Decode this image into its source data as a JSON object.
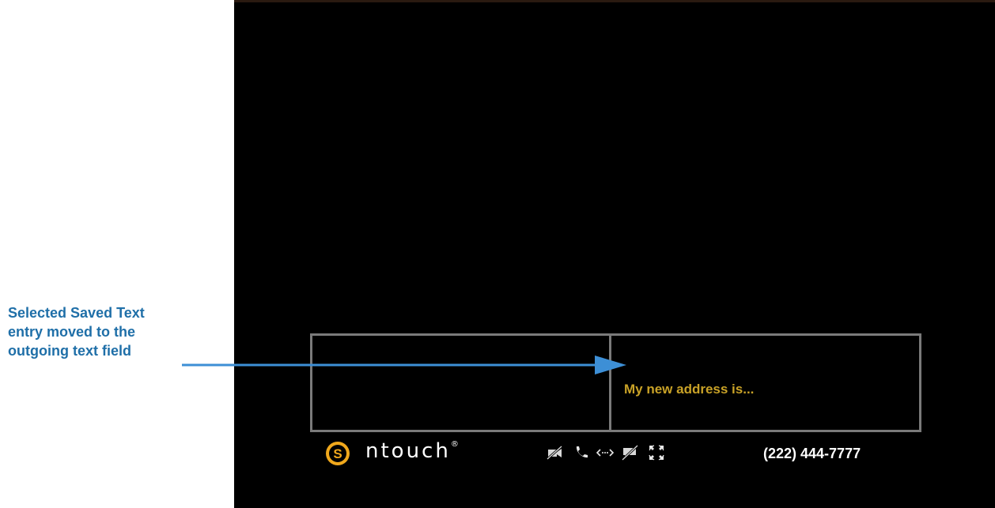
{
  "callout": {
    "lines": [
      "Selected Saved Text",
      "entry moved to the",
      "outgoing text field"
    ],
    "color": "#1f6fa8"
  },
  "outgoing_field": {
    "text": "My new address is...",
    "color": "#c9a227"
  },
  "status_bar": {
    "brand": "ntouch",
    "brand_mark": "®",
    "icons": [
      "video-off-icon",
      "phone-icon",
      "relay-icon",
      "chat-off-icon",
      "fullscreen-icon"
    ],
    "phone_number": "(222) 444-7777"
  }
}
